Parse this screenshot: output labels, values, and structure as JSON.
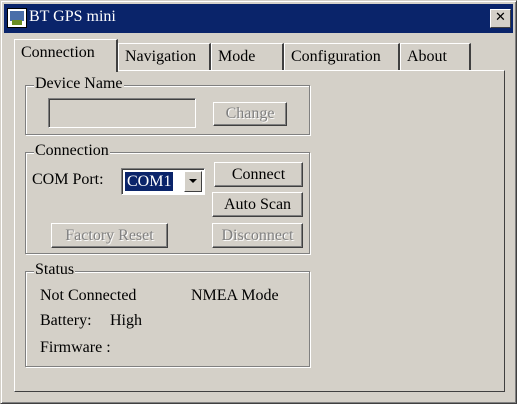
{
  "window": {
    "title": "BT GPS mini",
    "close_glyph": "✕"
  },
  "tabs": [
    {
      "label": "Connection",
      "active": true
    },
    {
      "label": "Navigation",
      "active": false
    },
    {
      "label": "Mode",
      "active": false
    },
    {
      "label": "Configuration",
      "active": false
    },
    {
      "label": "About",
      "active": false
    }
  ],
  "device_name": {
    "group_label": "Device Name",
    "value": "",
    "change_button": "Change"
  },
  "connection": {
    "group_label": "Connection",
    "com_port_label": "COM  Port:",
    "com_port_value": "COM1",
    "connect_button": "Connect",
    "auto_scan_button": "Auto Scan",
    "factory_reset_button": "Factory Reset",
    "disconnect_button": "Disconnect"
  },
  "status": {
    "group_label": "Status",
    "connection_state": "Not Connected",
    "mode": "NMEA Mode",
    "battery_label": "Battery:",
    "battery_value": "High",
    "firmware_label": "Firmware :"
  },
  "colors": {
    "titlebar": "#0a246a",
    "face": "#d4d0c8",
    "disabled_text": "#808080"
  }
}
